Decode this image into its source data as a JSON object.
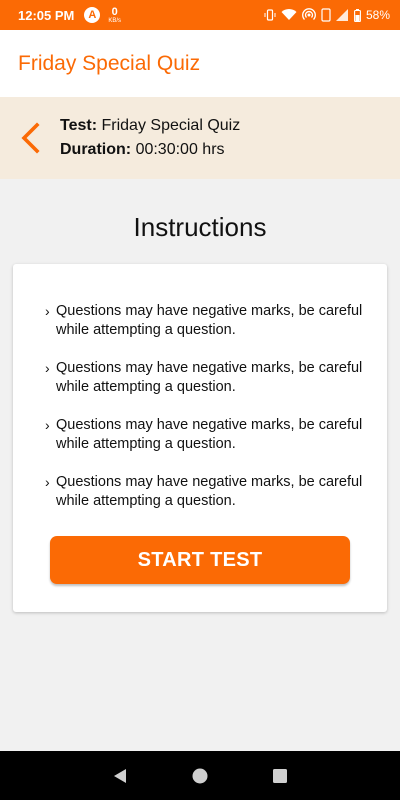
{
  "status_bar": {
    "time": "12:05 PM",
    "app_badge": "A",
    "net_speed_value": "0",
    "net_speed_unit": "KB/s",
    "battery_percent": "58%",
    "icons": [
      "vibrate-icon",
      "wifi-icon",
      "hotspot-icon",
      "phone-icon",
      "signal-icon",
      "battery-icon"
    ]
  },
  "app_bar": {
    "title": "Friday Special Quiz"
  },
  "test_info": {
    "test_label": "Test:",
    "test_name": "Friday Special Quiz",
    "duration_label": "Duration:",
    "duration_value": "00:30:00 hrs"
  },
  "instructions": {
    "heading": "Instructions",
    "items": [
      "Questions may have negative marks, be careful while attempting a question.",
      "Questions may have negative marks, be careful while attempting a question.",
      "Questions may have negative marks, be careful while attempting a question.",
      "Questions may have negative marks, be careful while attempting a question."
    ],
    "bullet": "›"
  },
  "start_button_label": "START TEST",
  "nav_bar": {
    "icons": [
      "back-triangle-icon",
      "home-circle-icon",
      "recents-square-icon"
    ]
  },
  "colors": {
    "accent": "#fb6a05",
    "info_bg": "#f5ebdd",
    "page_bg": "#f1f1f1"
  }
}
